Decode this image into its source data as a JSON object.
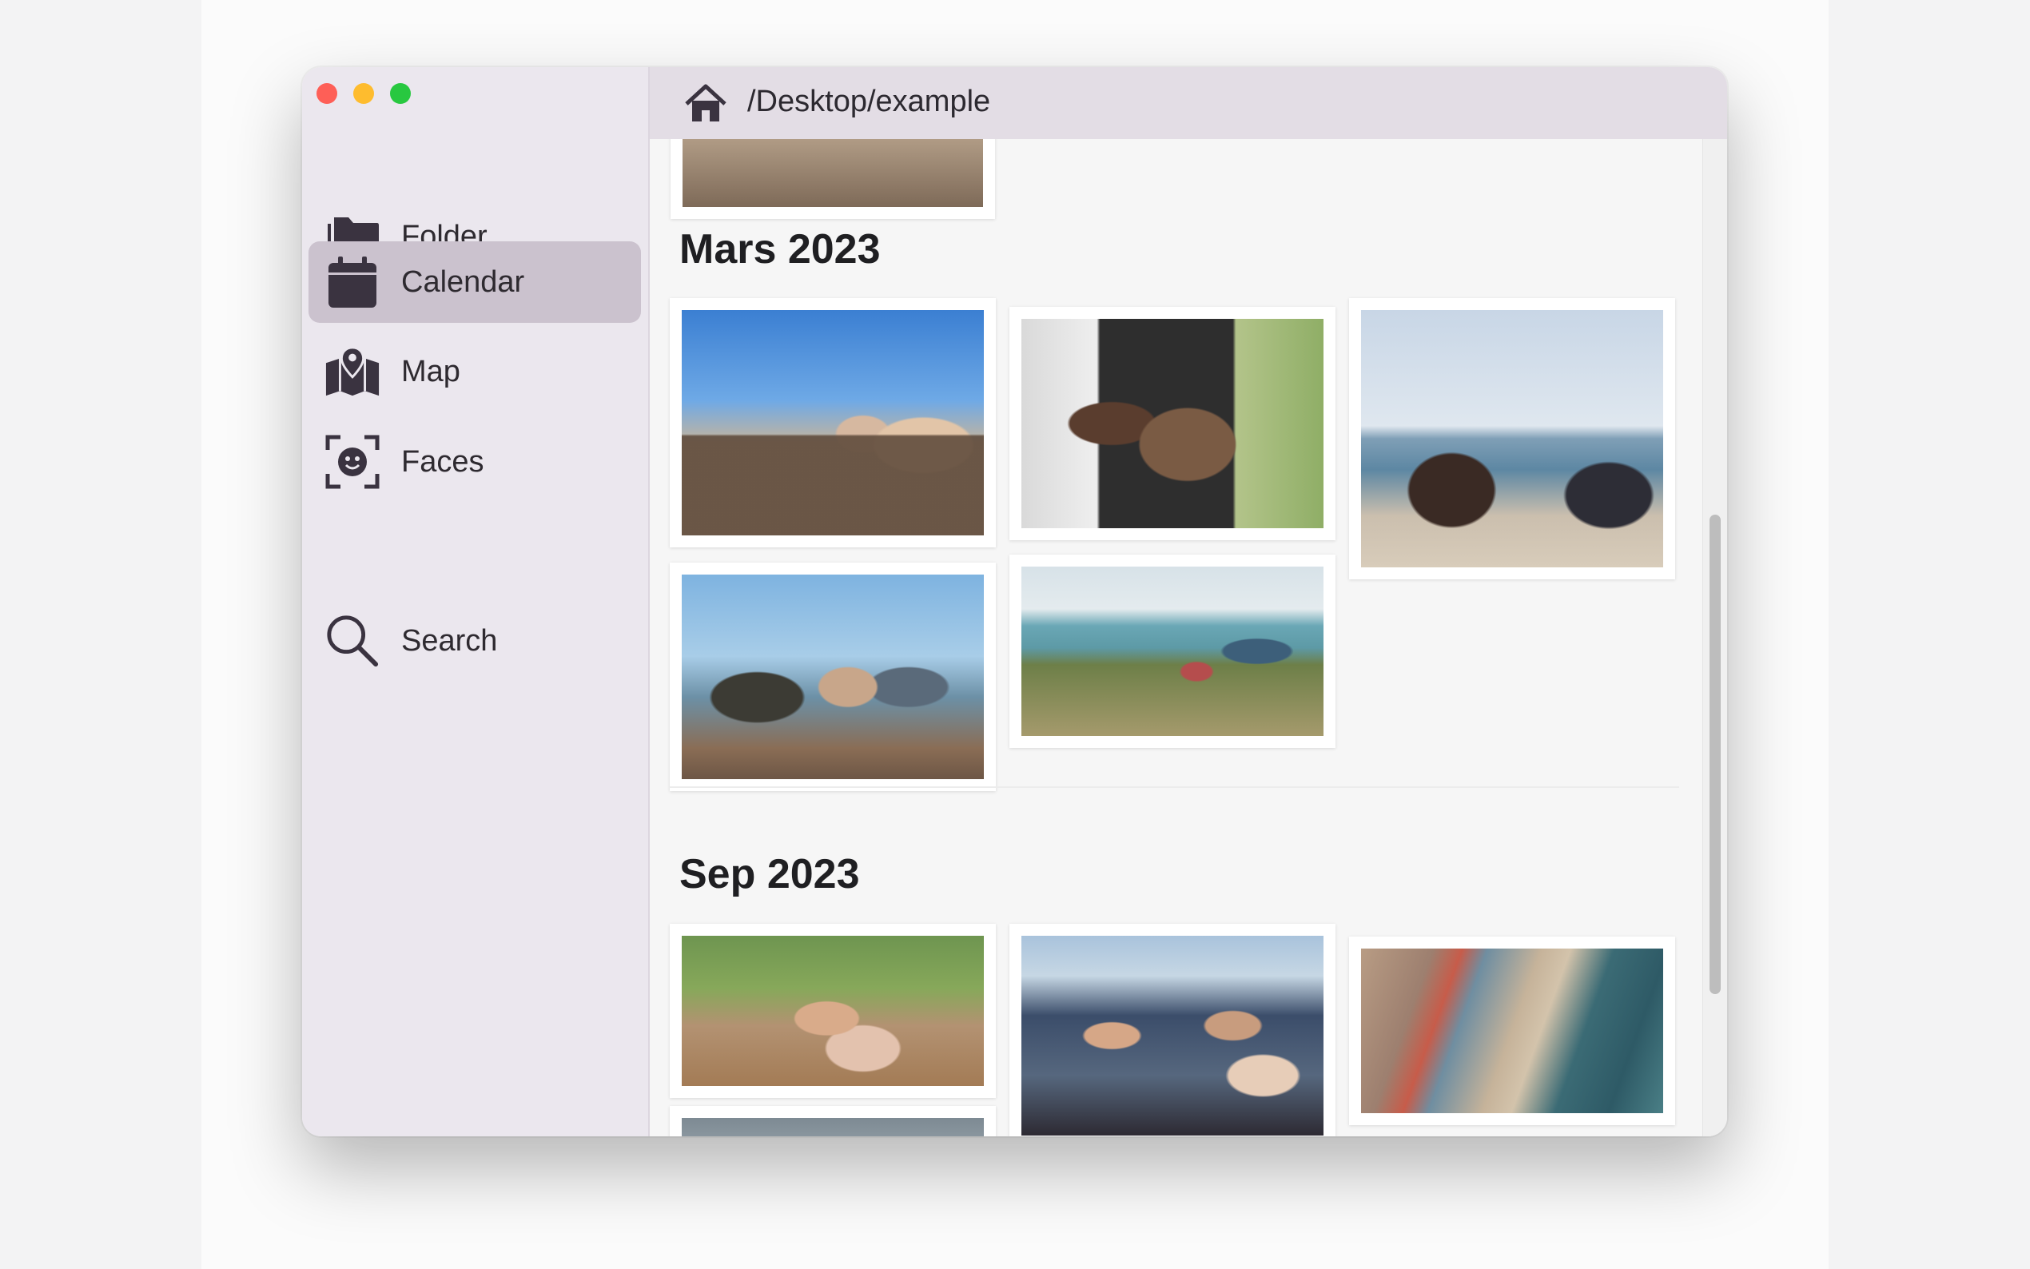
{
  "window": {
    "controls": [
      "close",
      "minimize",
      "zoom"
    ]
  },
  "sidebar": {
    "items": [
      {
        "label": "Folder",
        "icon": "folder-icon",
        "active": false
      },
      {
        "label": "Calendar",
        "icon": "calendar-icon",
        "active": true
      },
      {
        "label": "Map",
        "icon": "map-icon",
        "active": false
      },
      {
        "label": "Faces",
        "icon": "faces-icon",
        "active": false
      },
      {
        "label": "Search",
        "icon": "search-icon",
        "active": false
      }
    ]
  },
  "pathbar": {
    "icon": "home-icon",
    "path": "/Desktop/example"
  },
  "gallery": {
    "sections": [
      {
        "title": "Mars 2023",
        "photo_count": 5
      },
      {
        "title": "Sep 2023",
        "photo_count": 4
      }
    ]
  },
  "colors": {
    "sidebar_bg": "#ebe7ee",
    "active_item": "#cbc2ce",
    "pathbar_bg": "#e3dde5",
    "close": "#fe5f57",
    "minimize": "#febc2e",
    "zoom": "#28c840"
  }
}
